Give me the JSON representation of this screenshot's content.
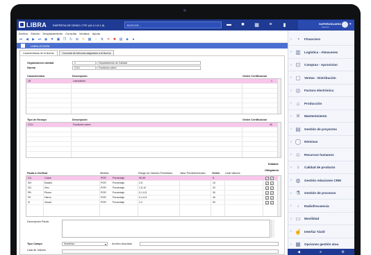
{
  "app": {
    "brand": "LIBRA",
    "company": "EMPRESA DE DEMO LTFE  (v6.4.1.8.1.8)",
    "search_placeholder": "BUSCAR...",
    "user_name": "SUPERUSUARIO",
    "user_sub": "sistema",
    "colors": {
      "appbar": "#1f3a93",
      "selected_row": "#f7c6ea",
      "sidebar_bg": "#f4f6fb"
    }
  },
  "menu": [
    "Archivo",
    "Edición",
    "Desplazamiento",
    "Consulta",
    "Ventana",
    "Ayuda"
  ],
  "window_title": "LIBRA-ECDEM",
  "tabs": [
    {
      "label": "Características de la Norma"
    },
    {
      "label": "Consulta de Artículos asignados a la Norma"
    }
  ],
  "form": {
    "org_label": "Organización calidad",
    "org_code": "1",
    "org_name": "Departamento de Calidad",
    "norma_label": "Norma",
    "norma_code": "CCU",
    "norma_name": "Fundición cobre"
  },
  "characteristics": {
    "headers": {
      "code": "Característica",
      "desc": "Descripción",
      "orden": "Orden Certificación"
    },
    "rows": [
      {
        "code": "LB",
        "desc": "Laboratorio",
        "orden": "1"
      }
    ]
  },
  "tests": {
    "headers": {
      "code": "Tipo de Ensayo",
      "desc": "Descripción",
      "orden": "Orden Certificación"
    },
    "rows": [
      {
        "code": "CCU",
        "desc": "Fundición cobre",
        "orden": "40"
      }
    ]
  },
  "verify": {
    "side_labels": {
      "editable": "Editable",
      "obligatorio": "Obligatorio"
    },
    "headers": {
      "pauta": "Pauta a Verificar",
      "medida": "Medida",
      "rango": "Rango de Valores Permitidos",
      "predet": "Valor Predeterminado",
      "orden": "Orden",
      "lista": "Lista Valores"
    },
    "rows": [
      {
        "code": "CU",
        "desc": "Cobre",
        "medida": "POR",
        "tipo": "Porcentaje",
        "rango": "90-99",
        "orden": "5"
      },
      {
        "code": "SN",
        "desc": "Estaño",
        "medida": "POR",
        "tipo": "Porcentaje",
        "rango": "2-5",
        "orden": "10"
      },
      {
        "code": "ZN",
        "desc": "Zinc",
        "medida": "POR",
        "tipo": "Porcentaje",
        "rango": "1,5-10",
        "orden": "20"
      },
      {
        "code": "PB",
        "desc": "Plomo",
        "medida": "POR",
        "tipo": "Porcentaje",
        "rango": "0,1-0,5",
        "orden": "30"
      },
      {
        "code": "FE",
        "desc": "Hierro",
        "medida": "POR",
        "tipo": "Porcentaje",
        "rango": "0,1-0,5",
        "orden": "40"
      },
      {
        "code": "VI",
        "desc": "Visual",
        "medida": "POR",
        "tipo": "Porcentaje",
        "rango": "1-2",
        "orden": "50"
      }
    ]
  },
  "bottom": {
    "description_label": "Descripción Pauta",
    "tipo_campo_label": "Tipo Campo",
    "tipo_campo_value": "Numérico",
    "archivo_label": "Archivo Asociado",
    "lista_label": "Lista de Valores"
  },
  "sidebar": {
    "items": [
      {
        "label": "Financiero",
        "icon": "chart-icon"
      },
      {
        "label": "Logística - Almacenes",
        "icon": "warehouse-icon"
      },
      {
        "label": "Compras - Aprovision",
        "icon": "cart-icon"
      },
      {
        "label": "Ventas - Distribución",
        "icon": "bag-icon"
      },
      {
        "label": "Factura electrónica",
        "icon": "invoice-icon"
      },
      {
        "label": "Producción",
        "icon": "factory-icon"
      },
      {
        "label": "Mantenimiento",
        "icon": "tools-icon"
      },
      {
        "label": "Gestión de proyectos",
        "icon": "project-icon"
      },
      {
        "label": "Nóminas",
        "icon": "payroll-icon"
      },
      {
        "label": "Recursos humanos",
        "icon": "people-icon"
      },
      {
        "label": "Calidad de producto",
        "icon": "quality-icon"
      },
      {
        "label": "Gestión relaciones CRM",
        "icon": "crm-icon"
      },
      {
        "label": "Gestión de procesos",
        "icon": "process-icon"
      },
      {
        "label": "Radiofrecuencia",
        "icon": "rf-icon"
      },
      {
        "label": "Movilidad",
        "icon": "mobile-icon"
      },
      {
        "label": "Interfaz Táctil",
        "icon": "touch-icon"
      },
      {
        "label": "Opciones gestión área",
        "icon": "options-icon"
      }
    ]
  }
}
